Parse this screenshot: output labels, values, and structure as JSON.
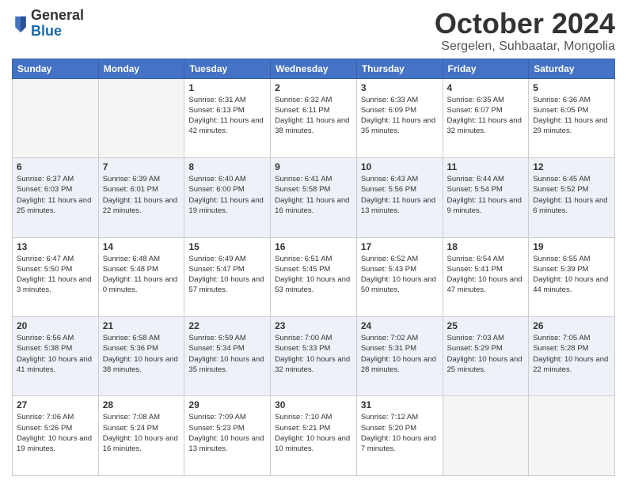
{
  "header": {
    "logo": {
      "general": "General",
      "blue": "Blue"
    },
    "title": "October 2024",
    "subtitle": "Sergelen, Suhbaatar, Mongolia"
  },
  "days_of_week": [
    "Sunday",
    "Monday",
    "Tuesday",
    "Wednesday",
    "Thursday",
    "Friday",
    "Saturday"
  ],
  "weeks": [
    [
      {
        "day": "",
        "info": ""
      },
      {
        "day": "",
        "info": ""
      },
      {
        "day": "1",
        "info": "Sunrise: 6:31 AM\nSunset: 6:13 PM\nDaylight: 11 hours and 42 minutes."
      },
      {
        "day": "2",
        "info": "Sunrise: 6:32 AM\nSunset: 6:11 PM\nDaylight: 11 hours and 38 minutes."
      },
      {
        "day": "3",
        "info": "Sunrise: 6:33 AM\nSunset: 6:09 PM\nDaylight: 11 hours and 35 minutes."
      },
      {
        "day": "4",
        "info": "Sunrise: 6:35 AM\nSunset: 6:07 PM\nDaylight: 11 hours and 32 minutes."
      },
      {
        "day": "5",
        "info": "Sunrise: 6:36 AM\nSunset: 6:05 PM\nDaylight: 11 hours and 29 minutes."
      }
    ],
    [
      {
        "day": "6",
        "info": "Sunrise: 6:37 AM\nSunset: 6:03 PM\nDaylight: 11 hours and 25 minutes."
      },
      {
        "day": "7",
        "info": "Sunrise: 6:39 AM\nSunset: 6:01 PM\nDaylight: 11 hours and 22 minutes."
      },
      {
        "day": "8",
        "info": "Sunrise: 6:40 AM\nSunset: 6:00 PM\nDaylight: 11 hours and 19 minutes."
      },
      {
        "day": "9",
        "info": "Sunrise: 6:41 AM\nSunset: 5:58 PM\nDaylight: 11 hours and 16 minutes."
      },
      {
        "day": "10",
        "info": "Sunrise: 6:43 AM\nSunset: 5:56 PM\nDaylight: 11 hours and 13 minutes."
      },
      {
        "day": "11",
        "info": "Sunrise: 6:44 AM\nSunset: 5:54 PM\nDaylight: 11 hours and 9 minutes."
      },
      {
        "day": "12",
        "info": "Sunrise: 6:45 AM\nSunset: 5:52 PM\nDaylight: 11 hours and 6 minutes."
      }
    ],
    [
      {
        "day": "13",
        "info": "Sunrise: 6:47 AM\nSunset: 5:50 PM\nDaylight: 11 hours and 3 minutes."
      },
      {
        "day": "14",
        "info": "Sunrise: 6:48 AM\nSunset: 5:48 PM\nDaylight: 11 hours and 0 minutes."
      },
      {
        "day": "15",
        "info": "Sunrise: 6:49 AM\nSunset: 5:47 PM\nDaylight: 10 hours and 57 minutes."
      },
      {
        "day": "16",
        "info": "Sunrise: 6:51 AM\nSunset: 5:45 PM\nDaylight: 10 hours and 53 minutes."
      },
      {
        "day": "17",
        "info": "Sunrise: 6:52 AM\nSunset: 5:43 PM\nDaylight: 10 hours and 50 minutes."
      },
      {
        "day": "18",
        "info": "Sunrise: 6:54 AM\nSunset: 5:41 PM\nDaylight: 10 hours and 47 minutes."
      },
      {
        "day": "19",
        "info": "Sunrise: 6:55 AM\nSunset: 5:39 PM\nDaylight: 10 hours and 44 minutes."
      }
    ],
    [
      {
        "day": "20",
        "info": "Sunrise: 6:56 AM\nSunset: 5:38 PM\nDaylight: 10 hours and 41 minutes."
      },
      {
        "day": "21",
        "info": "Sunrise: 6:58 AM\nSunset: 5:36 PM\nDaylight: 10 hours and 38 minutes."
      },
      {
        "day": "22",
        "info": "Sunrise: 6:59 AM\nSunset: 5:34 PM\nDaylight: 10 hours and 35 minutes."
      },
      {
        "day": "23",
        "info": "Sunrise: 7:00 AM\nSunset: 5:33 PM\nDaylight: 10 hours and 32 minutes."
      },
      {
        "day": "24",
        "info": "Sunrise: 7:02 AM\nSunset: 5:31 PM\nDaylight: 10 hours and 28 minutes."
      },
      {
        "day": "25",
        "info": "Sunrise: 7:03 AM\nSunset: 5:29 PM\nDaylight: 10 hours and 25 minutes."
      },
      {
        "day": "26",
        "info": "Sunrise: 7:05 AM\nSunset: 5:28 PM\nDaylight: 10 hours and 22 minutes."
      }
    ],
    [
      {
        "day": "27",
        "info": "Sunrise: 7:06 AM\nSunset: 5:26 PM\nDaylight: 10 hours and 19 minutes."
      },
      {
        "day": "28",
        "info": "Sunrise: 7:08 AM\nSunset: 5:24 PM\nDaylight: 10 hours and 16 minutes."
      },
      {
        "day": "29",
        "info": "Sunrise: 7:09 AM\nSunset: 5:23 PM\nDaylight: 10 hours and 13 minutes."
      },
      {
        "day": "30",
        "info": "Sunrise: 7:10 AM\nSunset: 5:21 PM\nDaylight: 10 hours and 10 minutes."
      },
      {
        "day": "31",
        "info": "Sunrise: 7:12 AM\nSunset: 5:20 PM\nDaylight: 10 hours and 7 minutes."
      },
      {
        "day": "",
        "info": ""
      },
      {
        "day": "",
        "info": ""
      }
    ]
  ]
}
